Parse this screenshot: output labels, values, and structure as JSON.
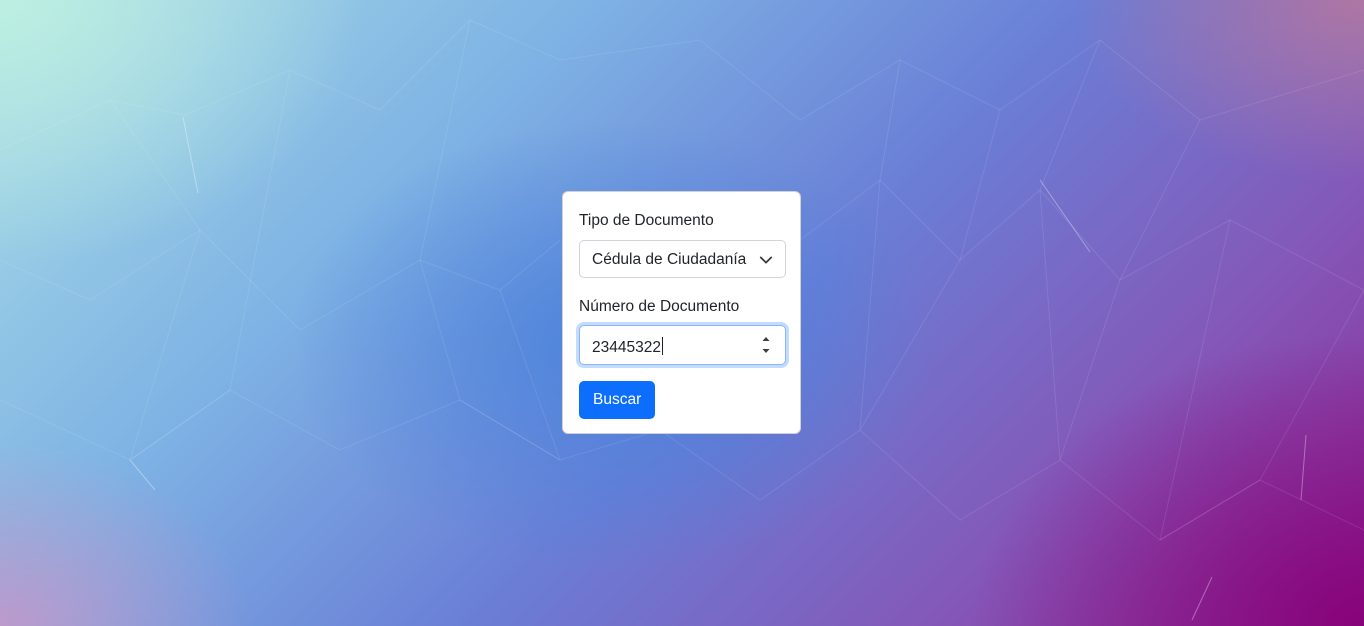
{
  "form": {
    "document_type_label": "Tipo de Documento",
    "document_type_value": "Cédula de Ciudadanía",
    "document_number_label": "Número de Documento",
    "document_number_value": "23445322",
    "search_button_label": "Buscar"
  },
  "icons": {
    "select_arrow": "chevron-down-icon",
    "spinner_up": "caret-up-icon",
    "spinner_down": "caret-down-icon"
  },
  "colors": {
    "accent": "#0d6efd",
    "focus_border": "#86b7fe"
  }
}
